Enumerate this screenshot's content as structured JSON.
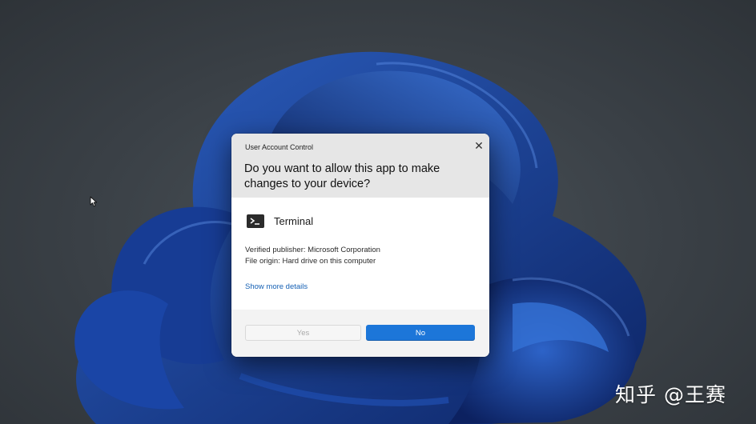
{
  "dialog": {
    "title": "User Account Control",
    "question": "Do you want to allow this app to make changes to your device?",
    "app_name": "Terminal",
    "app_icon": "terminal-icon",
    "publisher": "Verified publisher: Microsoft Corporation",
    "origin": "File origin: Hard drive on this computer",
    "more_details": "Show more details",
    "yes_label": "Yes",
    "no_label": "No",
    "close_label": "✕"
  },
  "watermark": "知乎 @王赛",
  "colors": {
    "accent": "#1c76d9",
    "link": "#1560b4",
    "header_bg": "#e6e6e6",
    "footer_bg": "#f3f3f3",
    "wallpaper_bloom": "#1d3f8a",
    "desktop_bg": "#3a4046"
  }
}
